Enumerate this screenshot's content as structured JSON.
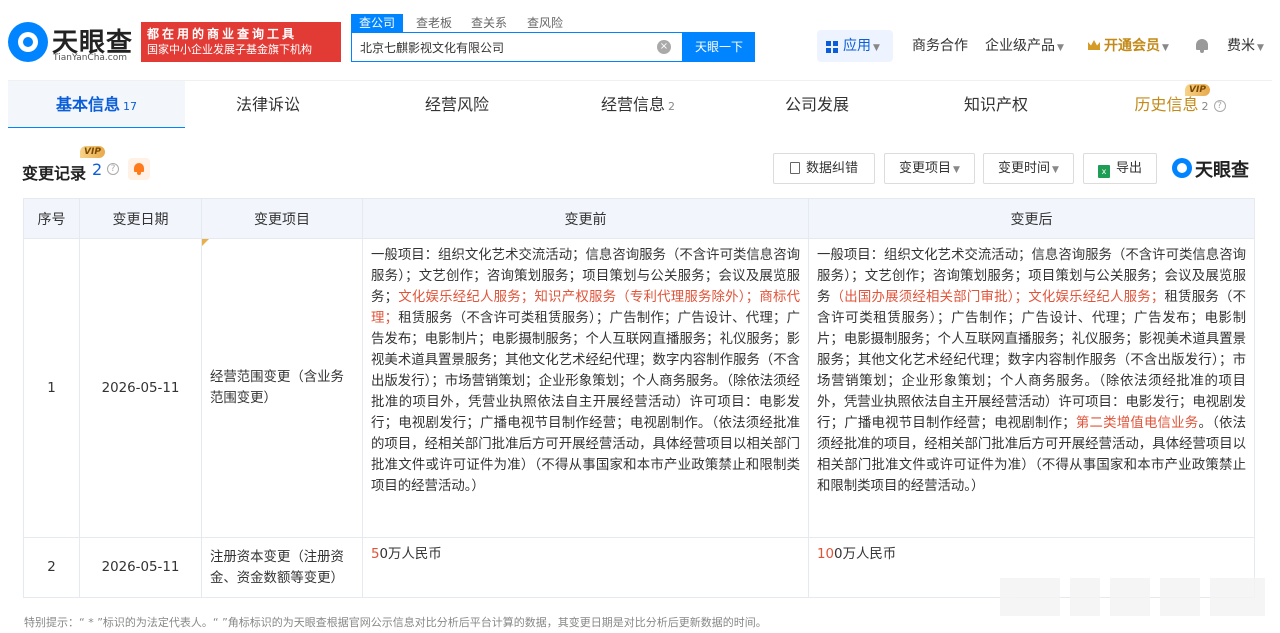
{
  "brand": {
    "name": "天眼查",
    "domain": "TianYanCha.com"
  },
  "promo": {
    "line1": "都在用的商业查询工具",
    "line2": "国家中小企业发展子基金旗下机构"
  },
  "search": {
    "tabs": [
      "查公司",
      "查老板",
      "查关系",
      "查风险"
    ],
    "query": "北京七麒影视文化有限公司",
    "clear": "×",
    "button": "天眼一下"
  },
  "topnav": {
    "apps": "应用",
    "business": "商务合作",
    "enterprise": "企业级产品",
    "vip": "开通会员",
    "user": "费米"
  },
  "tabs": [
    {
      "label": "基本信息",
      "count": "17"
    },
    {
      "label": "法律诉讼",
      "count": ""
    },
    {
      "label": "经营风险",
      "count": ""
    },
    {
      "label": "经营信息",
      "count": "2"
    },
    {
      "label": "公司发展",
      "count": ""
    },
    {
      "label": "知识产权",
      "count": ""
    },
    {
      "label": "历史信息",
      "count": "2"
    }
  ],
  "vip_badge": "VIP",
  "section": {
    "title": "变更记录",
    "count": "2",
    "vip": "VIP",
    "buttons": {
      "correct": "数据纠错",
      "item": "变更项目",
      "time": "变更时间",
      "export": "导出"
    }
  },
  "table": {
    "headers": [
      "序号",
      "变更日期",
      "变更项目",
      "变更前",
      "变更后"
    ],
    "rows": [
      {
        "no": "1",
        "date": "2026-05-11",
        "item": "经营范围变更（含业务范围变更）",
        "before": [
          {
            "t": "一般项目：组织文化艺术交流活动；信息咨询服务（不含许可类信息咨询服务）；文艺创作；咨询策划服务；项目策划与公关服务；会议及展览服务；",
            "hl": false
          },
          {
            "t": "文化娱乐经纪人服务；知识产权服务（专利代理服务除外）；商标代理；",
            "hl": true
          },
          {
            "t": "租赁服务（不含许可类租赁服务）；广告制作；广告设计、代理；广告发布；电影制片；电影摄制服务；个人互联网直播服务；礼仪服务；影视美术道具置景服务；其他文化艺术经纪代理；数字内容制作服务（不含出版发行）；市场营销策划；企业形象策划；个人商务服务。（除依法须经批准的项目外，凭营业执照依法自主开展经营活动）许可项目：电影发行；电视剧发行；广播电视节目制作经营；电视剧制作。（依法须经批准的项目，经相关部门批准后方可开展经营活动，具体经营项目以相关部门批准文件或许可证件为准）（不得从事国家和本市产业政策禁止和限制类项目的经营活动。）",
            "hl": false
          }
        ],
        "after": [
          {
            "t": "一般项目：组织文化艺术交流活动；信息咨询服务（不含许可类信息咨询服务）；文艺创作；咨询策划服务；项目策划与公关服务；会议及展览服务",
            "hl": false
          },
          {
            "t": "（出国办展须经相关部门审批）；文化娱乐经纪人服务；",
            "hl": true
          },
          {
            "t": "租赁服务（不含许可类租赁服务）；广告制作；广告设计、代理；广告发布；电影制片；电影摄制服务；个人互联网直播服务；礼仪服务；影视美术道具置景服务；其他文化艺术经纪代理；数字内容制作服务（不含出版发行）；市场营销策划；企业形象策划；个人商务服务。（除依法须经批准的项目外，凭营业执照依法自主开展经营活动）许可项目：电影发行；电视剧发行；广播电视节目制作经营；电视剧制作；",
            "hl": false
          },
          {
            "t": "第二类增值电信业务",
            "hl": true
          },
          {
            "t": "。（依法须经批准的项目，经相关部门批准后方可开展经营活动，具体经营项目以相关部门批准文件或许可证件为准）（不得从事国家和本市产业政策禁止和限制类项目的经营活动。）",
            "hl": false
          }
        ]
      },
      {
        "no": "2",
        "date": "2026-05-11",
        "item": "注册资本变更（注册资金、资金数额等变更）",
        "before": [
          {
            "t": "5",
            "hl": true
          },
          {
            "t": "0万人民币",
            "hl": false
          }
        ],
        "after": [
          {
            "t": "10",
            "hl": true
          },
          {
            "t": "0万人民币",
            "hl": false
          }
        ]
      }
    ]
  },
  "footnote": "特别提示：“ * ”标识的为法定代表人。“ ”角标标识的为天眼查根据官网公示信息对比分析后平台计算的数据，其变更日期是对比分析后更新数据的时间。",
  "colors": {
    "brand_blue": "#0084ff",
    "promo_red": "#e23b36",
    "highlight": "#e0543a",
    "vip_gold": "#c38a19"
  },
  "icons": [
    "search-clear-icon",
    "apps-grid-icon",
    "crown-icon",
    "bell-icon",
    "help-icon",
    "doc-icon",
    "excel-icon"
  ]
}
